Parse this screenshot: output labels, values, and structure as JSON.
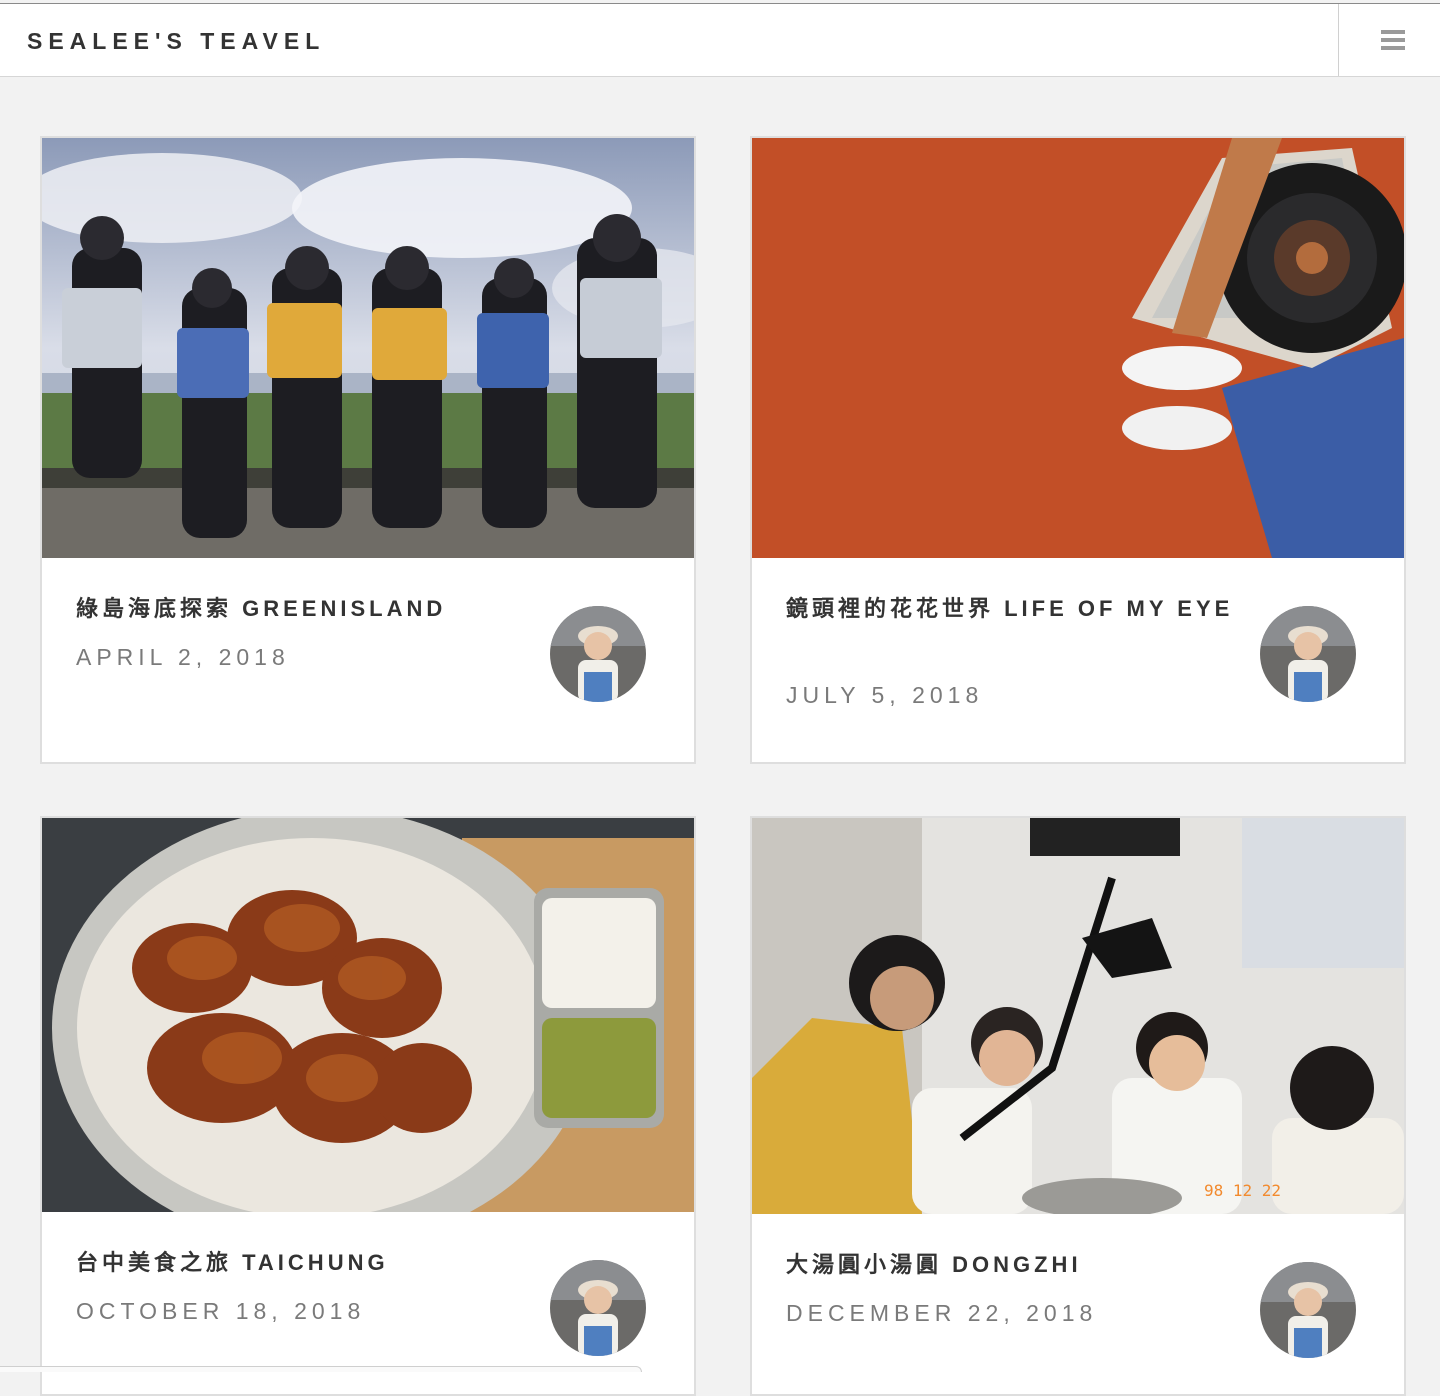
{
  "header": {
    "site_title": "SEALEE'S TEAVEL",
    "menu_icon": "hamburger-menu-icon"
  },
  "posts": [
    {
      "title": "綠島海底探索 GREENISLAND",
      "date": "APRIL 2, 2018",
      "photo_subject": "group of six friends in life vests doing tree pose by the sea",
      "avatar": "author-avatar"
    },
    {
      "title": "鏡頭裡的花花世界 LIFE OF MY EYE",
      "date": "JULY 5, 2018",
      "photo_subject": "camera lens over orange running track with white sneakers",
      "avatar": "author-avatar"
    },
    {
      "title": "台中美食之旅 TAICHUNG",
      "date": "OCTOBER 18, 2018",
      "photo_subject": "fried chicken platter with rice and beans",
      "avatar": "author-avatar"
    },
    {
      "title": "大湯圓小湯圓 DONGZHI",
      "date": "DECEMBER 22, 2018",
      "photo_subject": "four friends sitting under a desk lamp",
      "photo_stamp": "98 12 22",
      "avatar": "author-avatar"
    }
  ]
}
